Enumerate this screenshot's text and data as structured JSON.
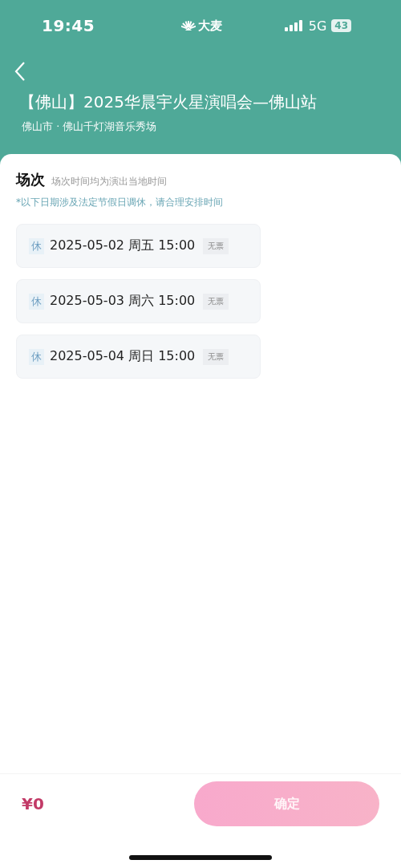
{
  "status_bar": {
    "time": "19:45",
    "brand": "大麦",
    "network": "5G",
    "battery": "43"
  },
  "header": {
    "title": "【佛山】2025华晨宇火星演唱会—佛山站",
    "venue": "佛山市 · 佛山千灯湖音乐秀场"
  },
  "sessions_section": {
    "heading": "场次",
    "hint": "场次时间均为演出当地时间",
    "notice": "*以下日期涉及法定节假日调休，请合理安排时间",
    "sessions": [
      {
        "holiday_tag": "休",
        "datetime": "2025-05-02 周五 15:00",
        "status": "无票",
        "selected": false
      },
      {
        "holiday_tag": "休",
        "datetime": "2025-05-03 周六 15:00",
        "status": "无票",
        "selected": false
      },
      {
        "holiday_tag": "休",
        "datetime": "2025-05-04 周日 15:00",
        "status": "无票",
        "selected": false
      }
    ]
  },
  "footer": {
    "price": "¥0",
    "confirm_button": {
      "label": "确定",
      "disabled": true
    }
  }
}
